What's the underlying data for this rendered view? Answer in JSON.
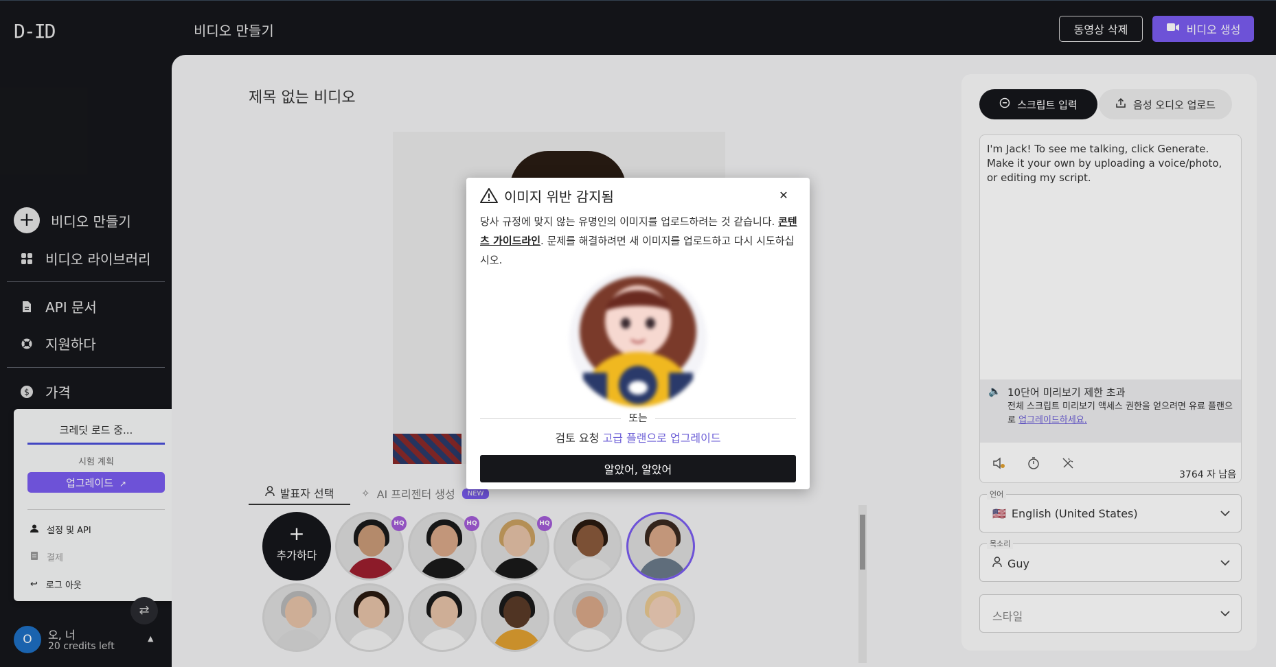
{
  "header": {
    "logo": "D-ID",
    "title": "비디오 만들기",
    "delete_label": "동영상 삭제",
    "generate_label": "비디오 생성"
  },
  "sidebar": {
    "items": [
      {
        "label": "비디오 만들기",
        "icon": "plus-circle-icon"
      },
      {
        "label": "비디오 라이브러리",
        "icon": "grid-icon"
      },
      {
        "label": "API 문서",
        "icon": "document-icon"
      },
      {
        "label": "지원하다",
        "icon": "lifebuoy-icon"
      },
      {
        "label": "가격",
        "icon": "dollar-icon"
      }
    ],
    "popup": {
      "loading": "크레딧 로드 중...",
      "plan": "시험 계획",
      "upgrade": "업그레이드",
      "menu": [
        {
          "label": "설정 및 API",
          "icon": "person-icon",
          "disabled": false
        },
        {
          "label": "결제",
          "icon": "receipt-icon",
          "disabled": true
        },
        {
          "label": "로그 아웃",
          "icon": "logout-icon",
          "disabled": false
        }
      ]
    },
    "user": {
      "initial": "O",
      "name": "오, 너",
      "credits": "20 credits left"
    }
  },
  "main": {
    "video_title": "제목 없는 비디오",
    "tabs": [
      {
        "label": "발표자 선택"
      },
      {
        "label": "AI 프리젠터 생성",
        "badge": "NEW"
      }
    ],
    "add_label": "추가하다",
    "avatars": [
      {
        "skin": "#c99a78",
        "clothes": "#9c1f2e",
        "hair": "#1a1a1a",
        "hq": true
      },
      {
        "skin": "#d8a888",
        "clothes": "#1a1a1a",
        "hair": "#1a1a1a",
        "hq": true
      },
      {
        "skin": "#e6c2a8",
        "clothes": "#1a1a1a",
        "hair": "#c9a060",
        "hq": true
      },
      {
        "skin": "#8a5a3c",
        "clothes": "#e8e8e8",
        "hair": "#2a1a10",
        "hq": false
      },
      {
        "skin": "#d8a888",
        "clothes": "#6a7a8a",
        "hair": "#3a2a20",
        "hq": false,
        "selected": true
      },
      {
        "skin": "#e6c2a8",
        "clothes": "#d8d8d8",
        "hair": "#b8b8b8",
        "hq": false
      },
      {
        "skin": "#e6c2a8",
        "clothes": "#f2f2f2",
        "hair": "#2a1a10",
        "hq": false
      },
      {
        "skin": "#e6c2a8",
        "clothes": "#f2f2f2",
        "hair": "#1a1a1a",
        "hq": false
      },
      {
        "skin": "#5a3a28",
        "clothes": "#e0a030",
        "hair": "#1a1a1a",
        "hq": false
      },
      {
        "skin": "#d8a888",
        "clothes": "#f2f2f2",
        "hair": "#c8c8c8",
        "hq": false
      },
      {
        "skin": "#f0cfb8",
        "clothes": "#f2f2f2",
        "hair": "#e8c890",
        "hq": false
      }
    ],
    "hq_label": "HQ"
  },
  "script": {
    "tab_script": "스크립트 입력",
    "tab_audio": "음성 오디오 업로드",
    "text": "I'm Jack! To see me talking, click Generate. Make it your own by uploading a voice/photo, or editing my script.",
    "limit_title": "10단어 미리보기 제한 초과",
    "limit_body": "전체 스크립트 미리보기 액세스 권한을 얻으려면 유료 플랜으로 ",
    "limit_link": "업그레이드하세요.",
    "chars_left": "3764 자 남음"
  },
  "settings": {
    "language_label": "언어",
    "language_value": "English (United States)",
    "language_flag": "🇺🇸",
    "voice_label": "목소리",
    "voice_value": "Guy",
    "style_placeholder": "스타일"
  },
  "modal": {
    "title": "이미지 위반 감지됨",
    "body_prefix": "당사 규정에 맞지 않는 유명인의 이미지를 업로드하려는 것 같습니다. ",
    "body_link": "콘텐츠 가이드라인",
    "body_suffix": ". 문제를 해결하려면 새 이미지를 업로드하고 다시 시도하십시오.",
    "or": "또는",
    "review_prefix": "검토 요청 ",
    "review_link": "고급 플랜으로 업그레이드",
    "ok_button": "알았어, 알았어"
  },
  "colors": {
    "accent": "#7a5cf0",
    "dark": "#16171b",
    "link": "#6a5cd6"
  }
}
